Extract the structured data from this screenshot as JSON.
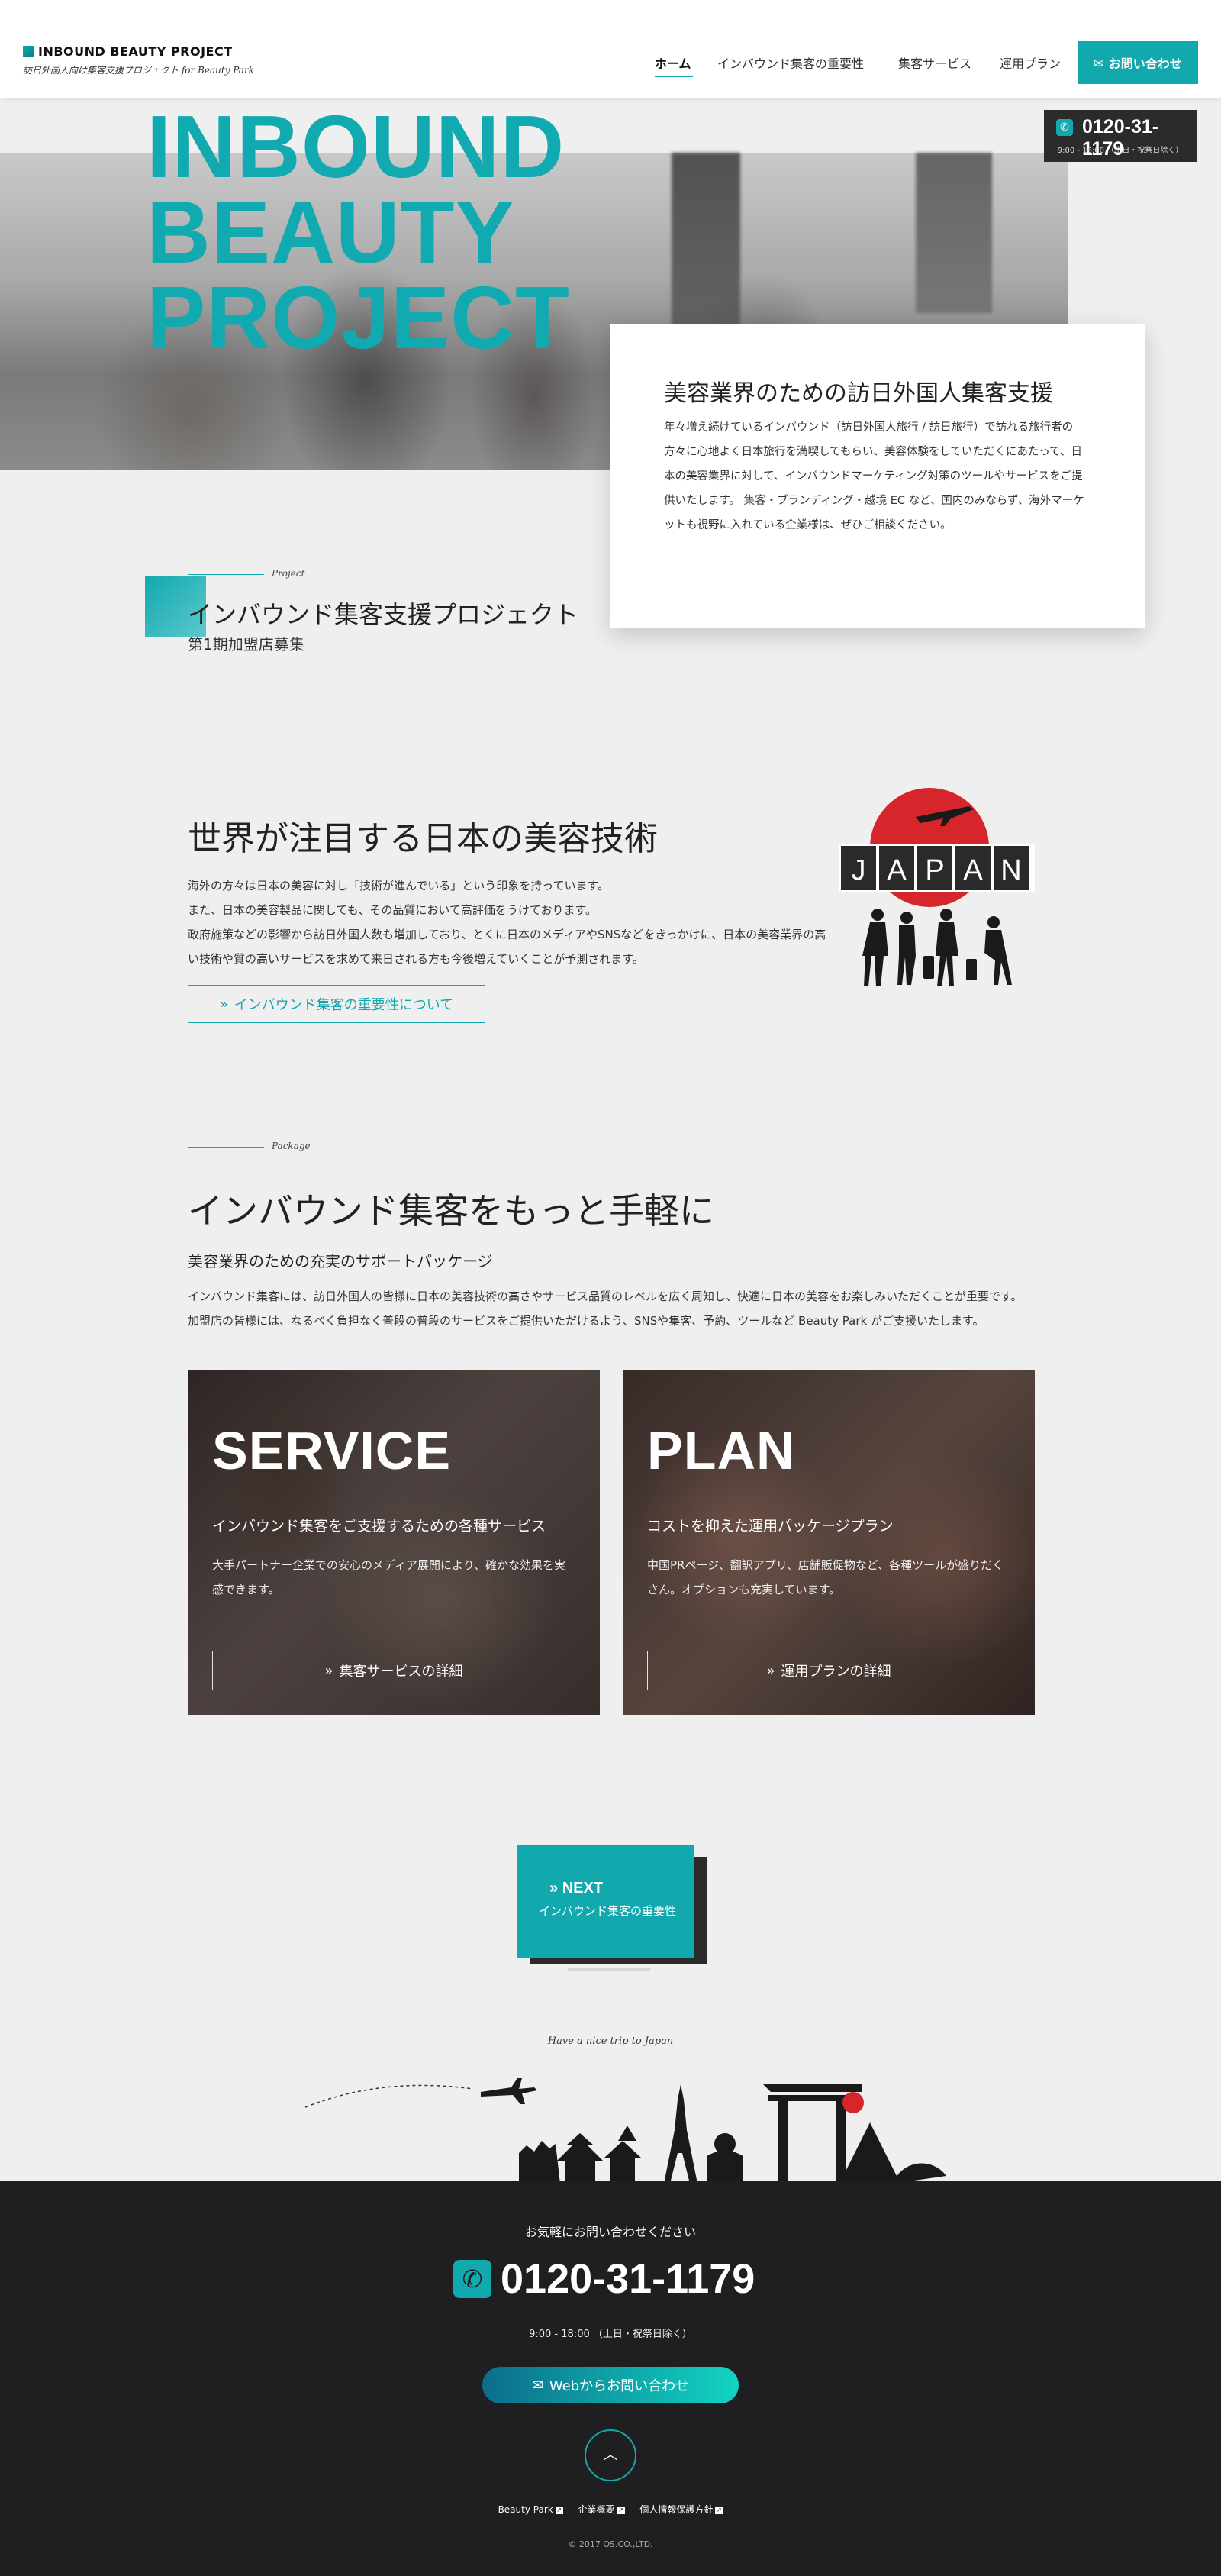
{
  "header": {
    "logo_title": "INBOUND BEAUTY PROJECT",
    "logo_sub": "訪日外国人向け集客支援プロジェクト for Beauty Park",
    "nav": [
      "ホーム",
      "インバウンド集客の重要性",
      "集客サービス",
      "運用プラン"
    ],
    "contact_label": "お問い合わせ",
    "phone": "0120-31-1179",
    "hours": "9:00 - 18:00 （土日・祝祭日除く）"
  },
  "hero": {
    "title_lines": [
      "INBOUND",
      "BEAUTY",
      "PROJECT"
    ],
    "card_title": "美容業界のための訪日外国人集客支援",
    "card_body": "年々増え続けているインバウンド（訪日外国人旅行 / 訪日旅行）で訪れる旅行者の方々に心地よく日本旅行を満喫してもらい、美容体験をしていただくにあたって、日本の美容業界に対して、インバウンドマーケティング対策のツールやサービスをご提供いたします。 集客・ブランディング・越境 EC など、国内のみならず、海外マーケットも視野に入れている企業様は、ぜひご相談ください。"
  },
  "project": {
    "label": "Project",
    "title": "インバウンド集客支援プロジェクト",
    "sub": "第1期加盟店募集"
  },
  "section2": {
    "title": "世界が注目する日本の美容技術",
    "lines": [
      "海外の方々は日本の美容に対し「技術が進んでいる」という印象を持っています。",
      "また、日本の美容製品に関しても、その品質において高評価をうけております。",
      "政府施策などの影響から訪日外国人数も増加しており、とくに日本のメディアやSNSなどをきっかけに、日本の美容業界の高い技術や質の高いサービスを求めて来日される方も今後増えていくことが予測されます。"
    ],
    "button": "インバウンド集客の重要性について",
    "japan_letters": [
      "J",
      "A",
      "P",
      "A",
      "N"
    ]
  },
  "section3": {
    "label": "Package",
    "title": "インバウンド集客をもっと手軽に",
    "sub": "美容業界のための充実のサポートパッケージ",
    "lines": [
      "インバウンド集客には、訪日外国人の皆様に日本の美容技術の高さやサービス品質のレベルを広く周知し、快適に日本の美容をお楽しみいただくことが重要です。",
      "加盟店の皆様には、なるべく負担なく普段の普段のサービスをご提供いただけるよう、SNSや集客、予約、ツールなど Beauty Park がご支援いたします。"
    ],
    "packages": [
      {
        "heading": "SERVICE",
        "sub": "インバウンド集客をご支援するための各種サービス",
        "body": "大手パートナー企業での安心のメディア展開により、確かな効果を実感できます。",
        "button": "集客サービスの詳細"
      },
      {
        "heading": "PLAN",
        "sub": "コストを抑えた運用パッケージプラン",
        "body": "中国PRページ、翻訳アプリ、店舗販促物など、各種ツールが盛りだくさん。オプションも充実しています。",
        "button": "運用プランの詳細"
      }
    ]
  },
  "next": {
    "label": "NEXT",
    "sub": "インバウンド集客の重要性"
  },
  "trip_text": "Have a nice trip to Japan",
  "footer": {
    "ask": "お気軽にお問い合わせください",
    "phone": "0120-31-1179",
    "hours": "9:00 - 18:00 （土日・祝祭日除く）",
    "web_button": "Webからお問い合わせ",
    "links": [
      "Beauty Park",
      "企業概要",
      "個人情報保護方針"
    ],
    "copyright": "© 2017 OS.CO.,LTD."
  },
  "colors": {
    "accent": "#11a8ae",
    "dark": "#1f1f21",
    "red": "#d6262b"
  },
  "icons": [
    "mail-icon",
    "phone-icon",
    "chevron-double-right-icon",
    "chevron-up-icon",
    "external-link-icon",
    "airplane-icon"
  ]
}
